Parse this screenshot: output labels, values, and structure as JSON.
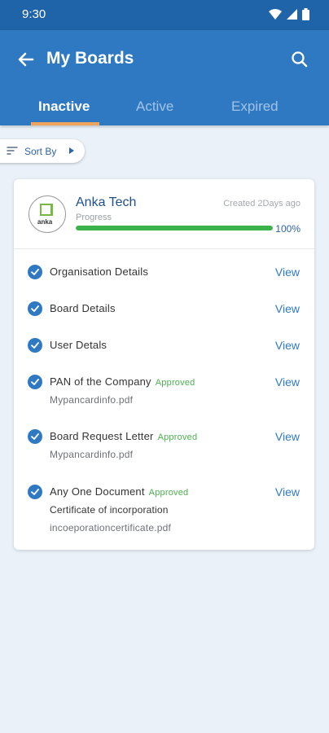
{
  "status_bar": {
    "time": "9:30"
  },
  "header": {
    "title": "My Boards"
  },
  "tabs": [
    {
      "label": "Inactive",
      "active": true
    },
    {
      "label": "Active",
      "active": false
    },
    {
      "label": "Expired",
      "active": false
    }
  ],
  "sort": {
    "label": "Sort By"
  },
  "board": {
    "logo_text": "anka",
    "company": "Anka Tech",
    "created": "Created 2Days ago",
    "progress_label": "Progress",
    "progress_value": 1.0,
    "progress_text": "100%",
    "items": [
      {
        "title": "Organisation Details",
        "badge": "",
        "view": "View"
      },
      {
        "title": "Board Details",
        "badge": "",
        "view": "View"
      },
      {
        "title": "User Detals",
        "badge": "",
        "view": "View"
      },
      {
        "title": "PAN of the Company",
        "badge": "Approved",
        "view": "View",
        "file": "Mypancardinfo.pdf"
      },
      {
        "title": "Board Request Letter",
        "badge": "Approved",
        "view": "View",
        "file": "Mypancardinfo.pdf"
      },
      {
        "title": "Any One Document",
        "badge": "Approved",
        "view": "View",
        "doc_type": "Certificate of incorporation",
        "file": "incoeporationcertificate.pdf"
      }
    ]
  },
  "colors": {
    "primary": "#2f79c3",
    "status_bar": "#1f64a8",
    "tab_indicator": "#f0a35a",
    "progress": "#3cb24a",
    "approved": "#4db04f",
    "background": "#eaf1f9"
  }
}
